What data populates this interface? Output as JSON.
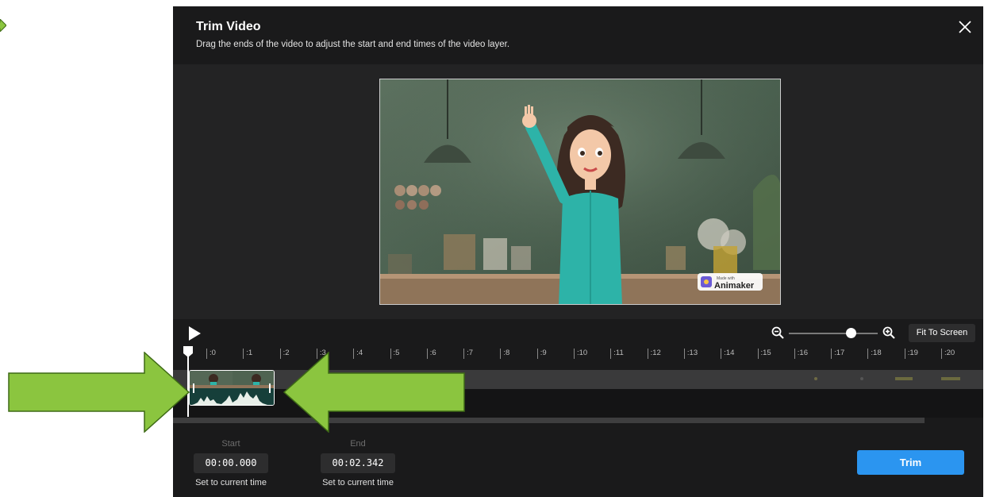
{
  "colors": {
    "modal_bg": "#1a1a1b",
    "preview_bg": "#232324",
    "accent_blue": "#2b95f0",
    "annotation_green": "#8bc53f",
    "annotation_outline": "#3e6a16"
  },
  "modal": {
    "title": "Trim Video",
    "subtitle": "Drag the ends of the video to adjust the start and end times of the video layer.",
    "close_icon": "close-icon"
  },
  "preview": {
    "watermark_small": "Made with",
    "watermark_brand": "Animaker"
  },
  "controls": {
    "play_icon": "play-icon",
    "zoom_out_icon": "zoom-out-icon",
    "zoom_in_icon": "zoom-in-icon",
    "zoom_level": 0.7,
    "fit_label": "Fit To Screen"
  },
  "timeline": {
    "ticks": [
      ":0",
      ":1",
      ":2",
      ":3",
      ":4",
      ":5",
      ":6",
      ":7",
      ":8",
      ":9",
      ":10",
      ":11",
      ":12",
      ":13",
      ":14",
      ":15",
      ":16",
      ":17",
      ":18",
      ":19",
      ":20"
    ]
  },
  "footer": {
    "start_label": "Start",
    "start_value": "00:00.000",
    "end_label": "End",
    "end_value": "00:02.342",
    "set_current_start": "Set to current time",
    "set_current_end": "Set to current time",
    "trim_label": "Trim"
  }
}
